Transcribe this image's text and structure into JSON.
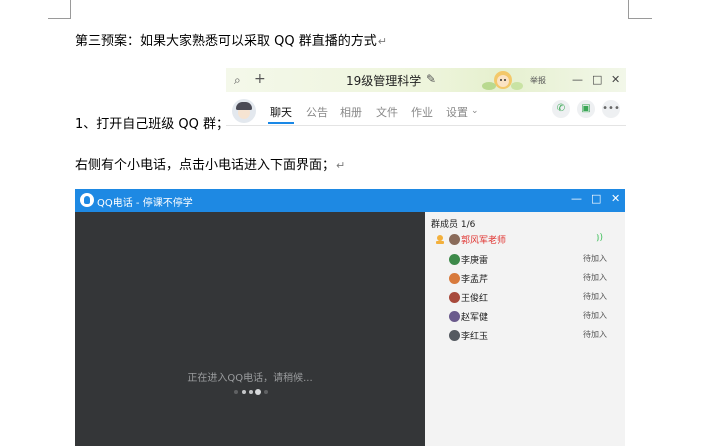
{
  "document": {
    "heading": "第三预案：如果大家熟悉可以采取 QQ 群直播的方式",
    "step1": "1、打开自己班级 QQ 群；",
    "step2": "右侧有个小电话，点击小电话进入下面界面；",
    "pilcrow": "↵"
  },
  "qq_group_window": {
    "title": "19级管理科学",
    "report_label": "举报",
    "tabs": [
      {
        "label": "聊天",
        "active": true
      },
      {
        "label": "公告",
        "active": false
      },
      {
        "label": "相册",
        "active": false
      },
      {
        "label": "文件",
        "active": false
      },
      {
        "label": "作业",
        "active": false
      },
      {
        "label": "设置",
        "active": false
      }
    ],
    "icons": [
      "search-icon",
      "add-icon",
      "edit-icon",
      "minimize-icon",
      "maximize-icon",
      "close-icon",
      "phone-icon",
      "share-screen-icon",
      "more-icon"
    ],
    "accent_color": "#1a88e6"
  },
  "qq_call_window": {
    "title": "QQ电话 - 停课不停学",
    "status_text": "正在进入QQ电话，请稍候...",
    "members_header": "群成员 1/6",
    "members": [
      {
        "name": "郭风军老师",
        "status": "",
        "host": true,
        "avatar_color": "#8a6b5a"
      },
      {
        "name": "李庚雷",
        "status": "待加入",
        "host": false,
        "avatar_color": "#3d8a4a"
      },
      {
        "name": "李孟芹",
        "status": "待加入",
        "host": false,
        "avatar_color": "#d87a3c"
      },
      {
        "name": "王俊红",
        "status": "待加入",
        "host": false,
        "avatar_color": "#a84a3c"
      },
      {
        "name": "赵军健",
        "status": "待加入",
        "host": false,
        "avatar_color": "#6a5a8c"
      },
      {
        "name": "李红玉",
        "status": "待加入",
        "host": false,
        "avatar_color": "#555a60"
      }
    ],
    "title_bar_color": "#1e89e3",
    "video_bg_color": "#343638"
  }
}
